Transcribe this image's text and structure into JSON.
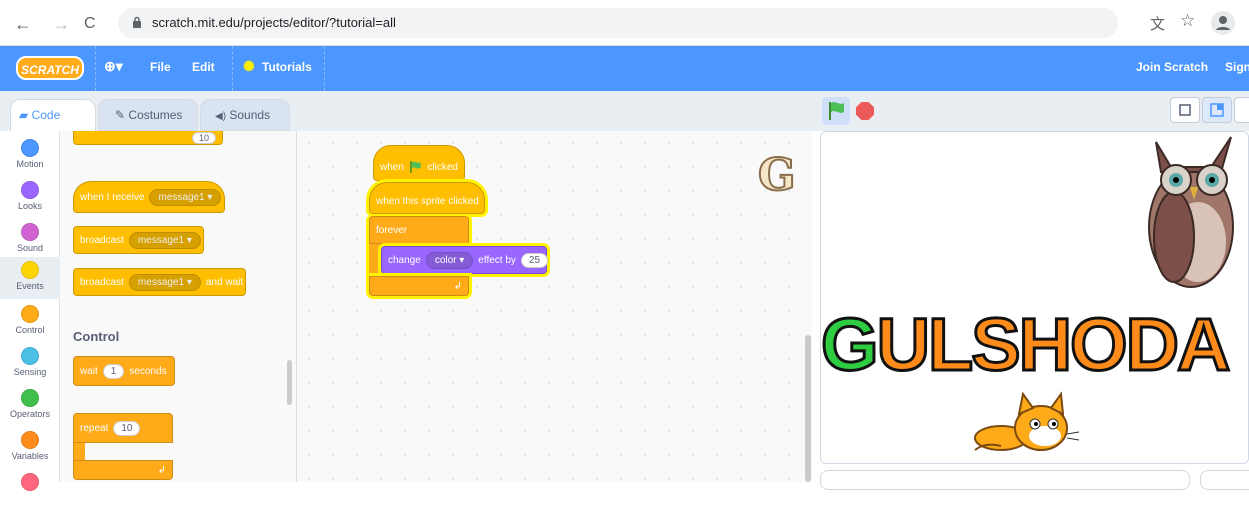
{
  "browser": {
    "back": "←",
    "forward": "→",
    "reload": "C",
    "url": "scratch.mit.edu/projects/editor/?tutorial=all"
  },
  "menubar": {
    "logo": "SCRATCH",
    "globe": "⊕▾",
    "file": "File",
    "edit": "Edit",
    "tutorials": "Tutorials",
    "join": "Join Scratch",
    "sign": "Sign"
  },
  "tabs": {
    "code": "Code",
    "costumes": "Costumes",
    "sounds": "Sounds"
  },
  "categories": [
    {
      "label": "Motion",
      "color": "#4c97ff"
    },
    {
      "label": "Looks",
      "color": "#9966ff"
    },
    {
      "label": "Sound",
      "color": "#cf63cf"
    },
    {
      "label": "Events",
      "color": "#ffd500"
    },
    {
      "label": "Control",
      "color": "#ffab19"
    },
    {
      "label": "Sensing",
      "color": "#4cbfe6"
    },
    {
      "label": "Operators",
      "color": "#40bf4a"
    },
    {
      "label": "Variables",
      "color": "#ff8c1a"
    }
  ],
  "palette": {
    "partial_value": "10",
    "when_receive": {
      "label": "when I receive",
      "message": "message1 ▾"
    },
    "broadcast": {
      "label": "broadcast",
      "message": "message1 ▾"
    },
    "broadcast_wait": {
      "label": "broadcast",
      "message": "message1 ▾",
      "suffix": "and wait"
    },
    "control_title": "Control",
    "wait": {
      "label": "wait",
      "value": "1",
      "suffix": "seconds"
    },
    "repeat": {
      "label": "repeat",
      "value": "10"
    }
  },
  "script": {
    "when_flag": {
      "prefix": "when",
      "suffix": "clicked"
    },
    "sprite_clicked": "when this sprite clicked",
    "forever": "forever",
    "change": {
      "label": "change",
      "effect": "color ▾",
      "mid": "effect by",
      "value": "25"
    },
    "g_letter": "G"
  },
  "stage": {
    "title_letters": [
      {
        "ch": "G",
        "color": "#2ecc40"
      },
      {
        "ch": "U",
        "color": "#ff8c1a"
      },
      {
        "ch": "L",
        "color": "#ff8c1a"
      },
      {
        "ch": "S",
        "color": "#ff8c1a"
      },
      {
        "ch": "H",
        "color": "#ff8c1a"
      },
      {
        "ch": "O",
        "color": "#ff8c1a"
      },
      {
        "ch": "D",
        "color": "#ff8c1a"
      },
      {
        "ch": "A",
        "color": "#ff8c1a"
      }
    ]
  }
}
